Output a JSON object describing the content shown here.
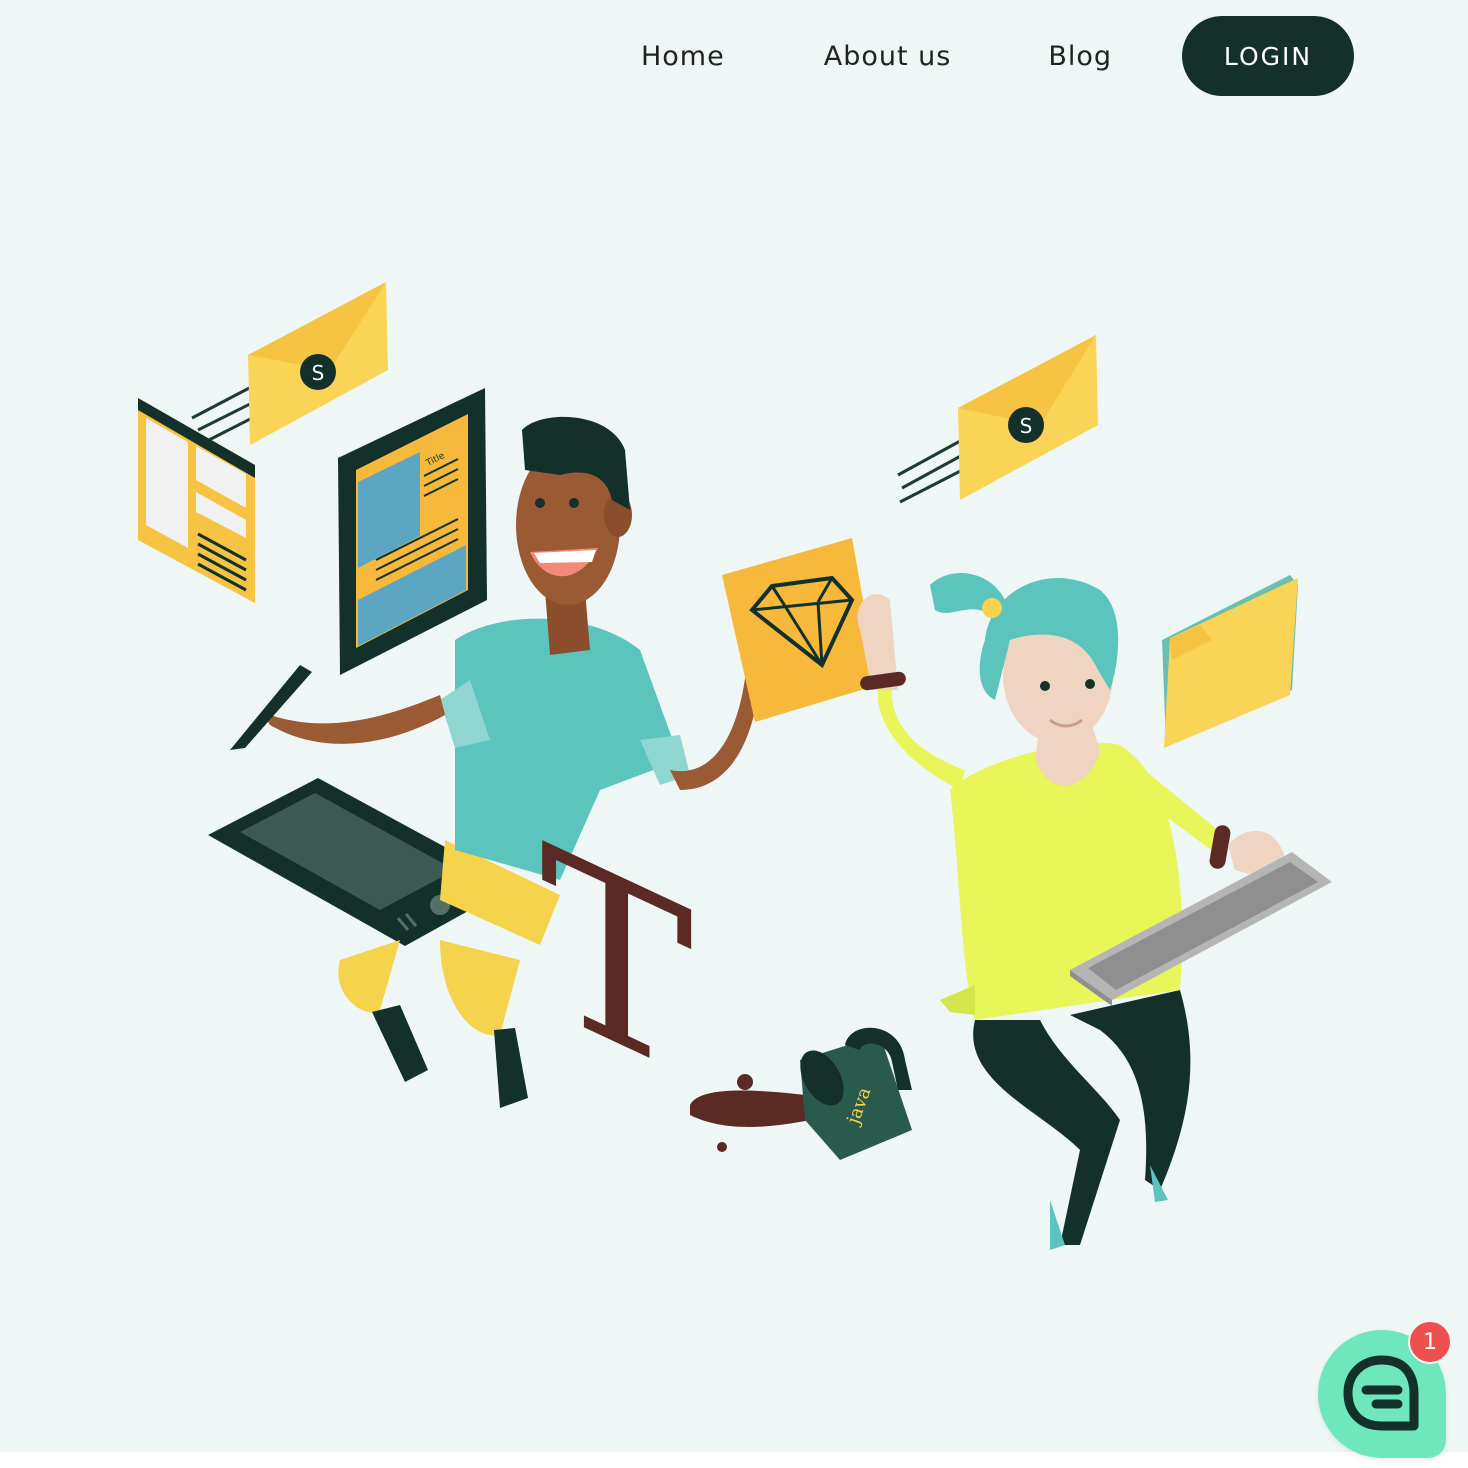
{
  "nav": {
    "links": [
      {
        "label": "Home"
      },
      {
        "label": "About us"
      },
      {
        "label": "Blog"
      }
    ],
    "login_label": "LOGIN"
  },
  "illustration": {
    "envelope_symbol": "S",
    "tablet_title": "Title",
    "type_letter": "T",
    "mug_label": "java"
  },
  "chat": {
    "icon": "chat-bubble-icon",
    "unread_count": "1"
  },
  "colors": {
    "background": "#eef7f6",
    "login_button": "#14302b",
    "chat_widget": "#6fe7bd",
    "badge": "#ee4f4f",
    "accent_yellow": "#f6c343",
    "accent_teal": "#58c4bd"
  }
}
